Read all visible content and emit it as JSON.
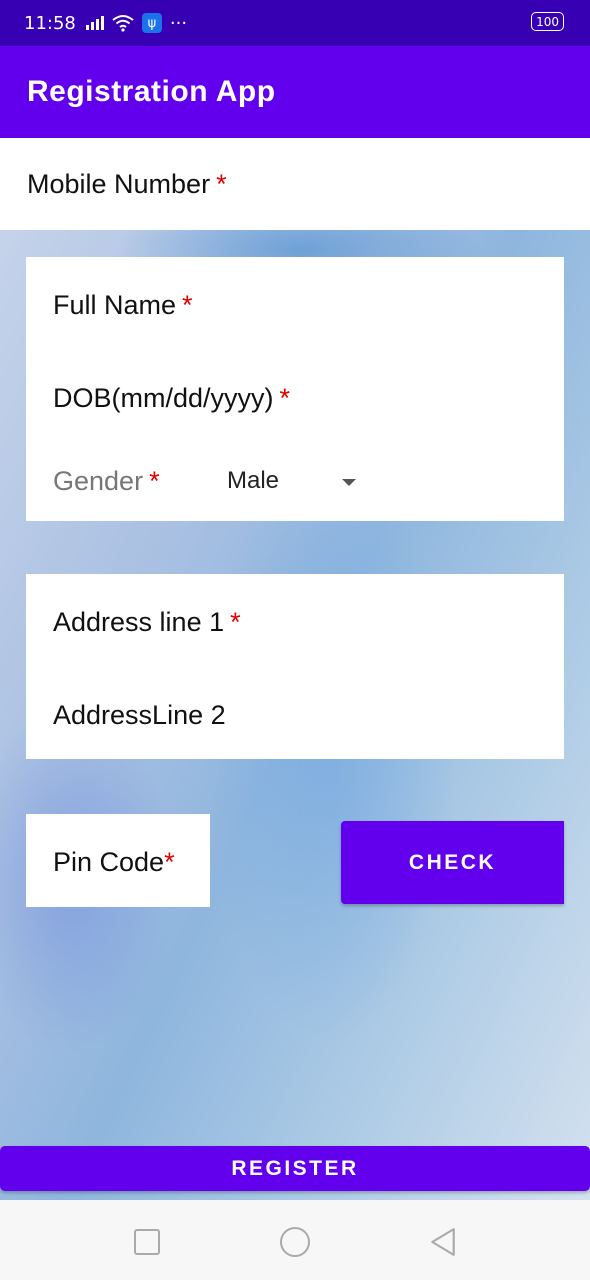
{
  "status_bar": {
    "time": "11:58",
    "more": "···",
    "battery": "100"
  },
  "app_bar": {
    "title": "Registration App"
  },
  "form": {
    "mobile_label": "Mobile Number",
    "required_mark": "*",
    "full_name_label": "Full Name",
    "dob_label": "DOB(mm/dd/yyyy)",
    "gender_label": "Gender",
    "gender_value": "Male",
    "address1_label": "Address line 1",
    "address2_label": "AddressLine 2",
    "pincode_label": "Pin Code"
  },
  "buttons": {
    "check": "CHECK",
    "register": "REGISTER"
  },
  "colors": {
    "primary": "#6200ee",
    "primary_dark": "#3700b3",
    "required": "#e00000"
  },
  "icons": {
    "wifi": "wifi-icon",
    "signal": "signal-icon",
    "usb": "usb-icon",
    "dropdown": "chevron-down-icon",
    "nav_recents": "square-icon",
    "nav_home": "circle-icon",
    "nav_back": "back-triangle-icon"
  }
}
